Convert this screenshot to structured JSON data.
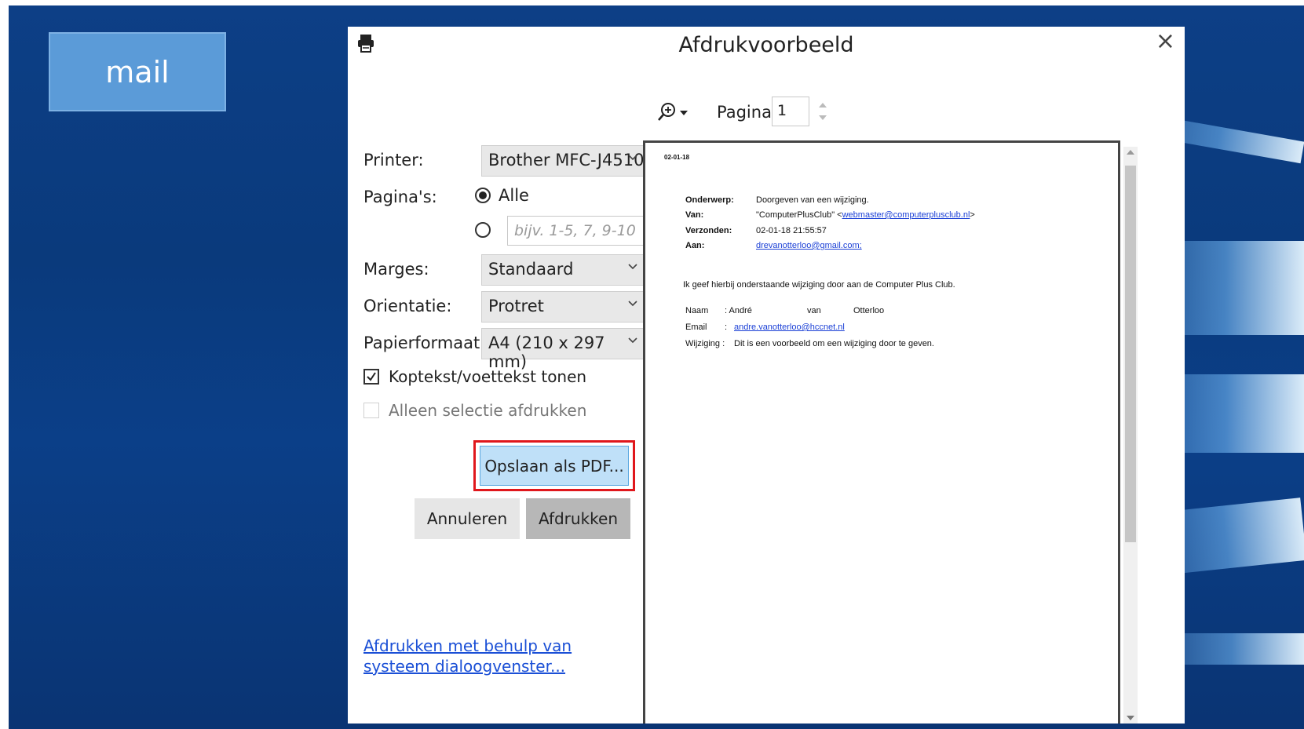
{
  "desktop": {
    "tile_label": "mail"
  },
  "dialog": {
    "title": "Afdrukvoorbeeld",
    "close_symbol": "×",
    "printer_label": "Printer:",
    "printer_value": "Brother MFC-J4510",
    "pages_label": "Pagina's:",
    "pages_all_label": "Alle",
    "pages_range_placeholder": "bijv. 1-5, 7, 9-10",
    "margins_label": "Marges:",
    "margins_value": "Standaard",
    "orientation_label": "Orientatie:",
    "orientation_value": "Protret",
    "paper_label": "Papierformaat:",
    "paper_value": "A4 (210 x 297 mm)",
    "header_footer_label": "Koptekst/voettekst tonen",
    "header_footer_checked": true,
    "selection_only_label": "Alleen selectie afdrukken",
    "selection_only_checked": false,
    "save_pdf_label": "Opslaan als PDF...",
    "cancel_label": "Annuleren",
    "print_label": "Afdrukken",
    "system_dialog_link": "Afdrukken met behulp van systeem dialoogvenster...",
    "page_label": "Pagina:",
    "page_value": "1",
    "highlight_color": "#e0171c"
  },
  "preview": {
    "date": "02-01-18",
    "subject_label": "Onderwerp:",
    "subject_value": "Doorgeven van een wijziging.",
    "from_label": "Van:",
    "from_name": "\"ComputerPlusClub\" <",
    "from_email": "webmaster@computerplusclub.nl",
    "from_end": ">",
    "sent_label": "Verzonden:",
    "sent_value": "02-01-18 21:55:57",
    "to_label": "Aan:",
    "to_value": "drevanotterloo@gmail.com;",
    "body_line": "Ik geef hierbij onderstaande wijziging door aan de Computer Plus Club.",
    "name_label": "Naam",
    "name_colon": ": André",
    "name_mid": "van",
    "name_last": "Otterloo",
    "email_label": "Email",
    "email_colon": ":",
    "email_value": "andre.vanotterloo@hccnet.nl",
    "change_label": "Wijziging :",
    "change_value": "Dit is een voorbeeld om een wijziging door te geven."
  }
}
